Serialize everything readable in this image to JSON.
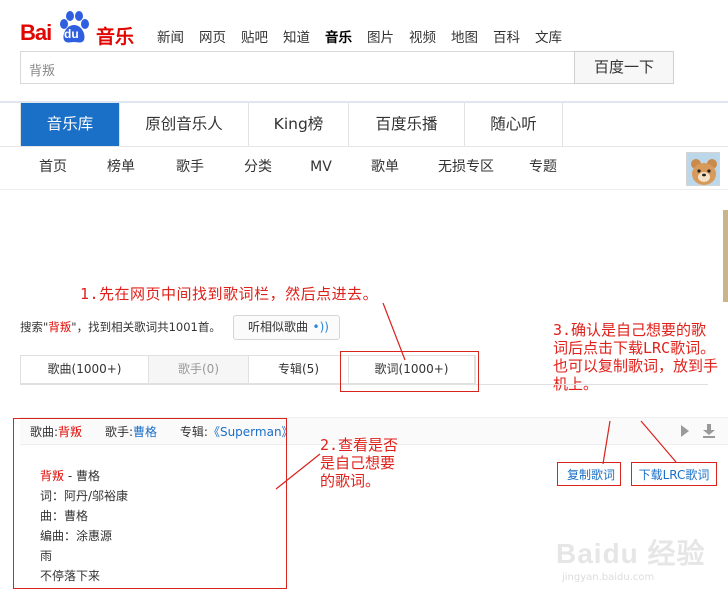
{
  "logo": {
    "text_bai": "Bai",
    "text_du": "du",
    "text_music": "音乐"
  },
  "topnav": [
    {
      "label": "新闻",
      "active": false
    },
    {
      "label": "网页",
      "active": false
    },
    {
      "label": "贴吧",
      "active": false
    },
    {
      "label": "知道",
      "active": false
    },
    {
      "label": "音乐",
      "active": true
    },
    {
      "label": "图片",
      "active": false
    },
    {
      "label": "视频",
      "active": false
    },
    {
      "label": "地图",
      "active": false
    },
    {
      "label": "百科",
      "active": false
    },
    {
      "label": "文库",
      "active": false
    }
  ],
  "search": {
    "value": "背叛",
    "button": "百度一下"
  },
  "maintabs": [
    "音乐库",
    "原创音乐人",
    "King榜",
    "百度乐播",
    "随心听"
  ],
  "subnav": [
    "首页",
    "榜单",
    "歌手",
    "分类",
    "MV",
    "歌单",
    "无损专区",
    "专题"
  ],
  "annotations": {
    "step1": "1.先在网页中间找到歌词栏，然后点进去。",
    "step2": "2.查看是否是自己想要的歌词。",
    "step3": "3.确认是自己想要的歌词后点击下载LRC歌词。也可以复制歌词，放到手机上。"
  },
  "result": {
    "prefix": "搜索\"",
    "keyword": "背叛",
    "suffix": "\"，找到相关歌词共1001首。",
    "similar_button": "听相似歌曲"
  },
  "typetabs": [
    {
      "label": "歌曲(1000+)",
      "state": "normal"
    },
    {
      "label": "歌手(0)",
      "state": "disabled"
    },
    {
      "label": "专辑(5)",
      "state": "normal"
    },
    {
      "label": "歌词(1000+)",
      "state": "active"
    }
  ],
  "songhead": {
    "song_label": "歌曲:",
    "song": "背叛",
    "singer_label": "歌手:",
    "singer": "曹格",
    "album_label": "专辑:",
    "album": "《Superman》"
  },
  "lyrics": {
    "title": "背叛",
    "title_suffix": " - 曹格",
    "lines": [
      "词：阿丹/邬裕康",
      "曲：曹格",
      "编曲：涂惠源",
      "雨",
      "不停落下来"
    ]
  },
  "actions": {
    "copy": "复制歌词",
    "download_lrc": "下载LRC歌词"
  },
  "watermark": {
    "brand": "Baidu 经验",
    "url": "jingyan.baidu.com"
  },
  "colors": {
    "accent_blue": "#1a6fc6",
    "brand_red": "#e10601",
    "annotation_red": "#e0201a"
  }
}
